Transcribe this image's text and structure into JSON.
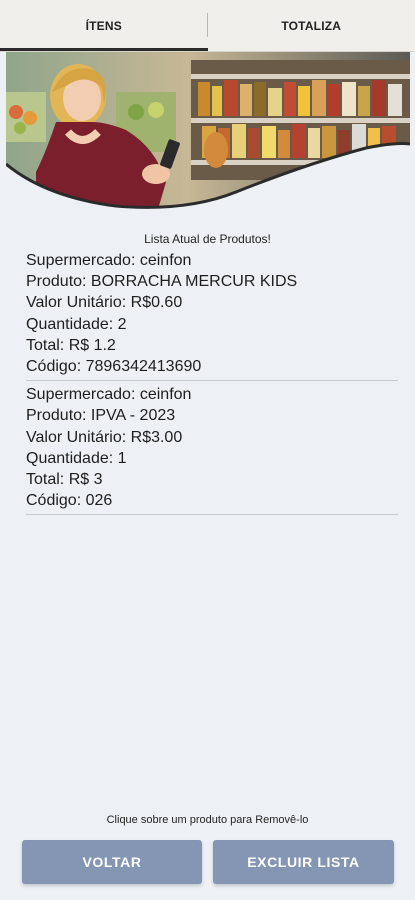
{
  "tabs": [
    {
      "label": "ÍTENS",
      "active": true
    },
    {
      "label": "TOTALIZA",
      "active": false
    }
  ],
  "banner": {
    "icon": "supermarket-shopper-photo"
  },
  "list_title": "Lista Atual de Produtos!",
  "products": [
    {
      "supermercado": "Supermercado: ceinfon",
      "produto": "Produto: BORRACHA MERCUR KIDS",
      "valor_unitario": "Valor Unitário: R$0.60",
      "quantidade": "Quantidade: 2",
      "total": "Total: R$ 1.2",
      "codigo": "Código: 7896342413690"
    },
    {
      "supermercado": "Supermercado: ceinfon",
      "produto": "Produto: IPVA - 2023",
      "valor_unitario": "Valor Unitário: R$3.00",
      "quantidade": "Quantidade: 1",
      "total": "Total: R$ 3",
      "codigo": "Código: 026"
    }
  ],
  "hint": "Clique sobre um produto para Removê-lo",
  "buttons": {
    "back_label": "VOLTAR",
    "clear_label": "EXCLUIR LISTA"
  },
  "colors": {
    "background": "#edf1f5",
    "button": "#8496b3",
    "tab_bar": "#f1efec"
  }
}
